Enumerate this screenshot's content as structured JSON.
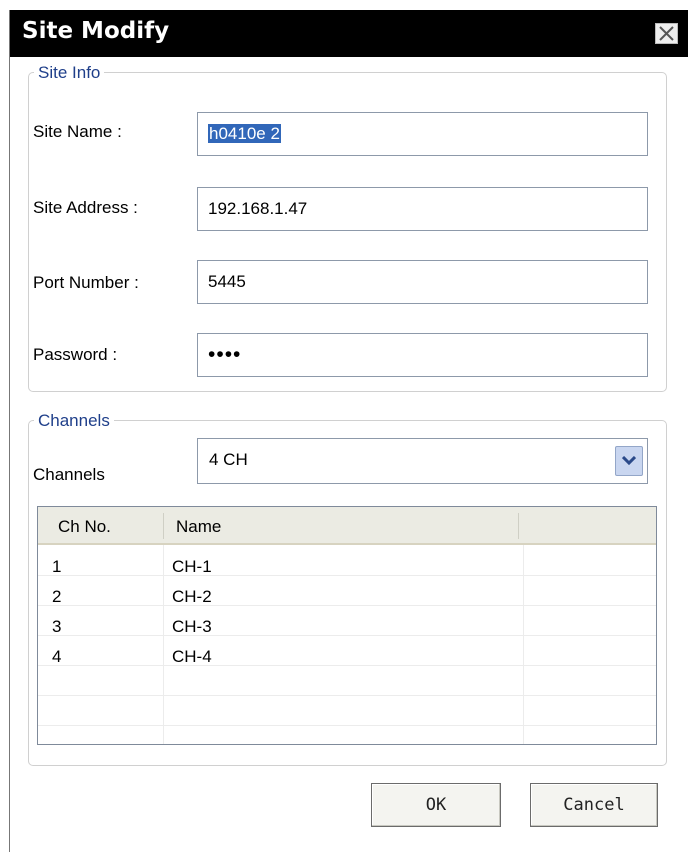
{
  "window": {
    "title": "Site Modify"
  },
  "site_info": {
    "legend": "Site Info",
    "fields": [
      {
        "label": "Site Name :",
        "value": "h0410e 2"
      },
      {
        "label": "Site Address :",
        "value": "192.168.1.47"
      },
      {
        "label": "Port Number :",
        "value": "5445"
      },
      {
        "label": "Password :",
        "value": "••••"
      }
    ]
  },
  "channels": {
    "legend": "Channels",
    "label": "Channels",
    "selected": "4 CH",
    "table": {
      "columns": [
        "Ch No.",
        "Name"
      ],
      "rows": [
        [
          "1",
          "CH-1"
        ],
        [
          "2",
          "CH-2"
        ],
        [
          "3",
          "CH-3"
        ],
        [
          "4",
          "CH-4"
        ]
      ]
    }
  },
  "buttons": {
    "ok": "OK",
    "cancel": "Cancel"
  },
  "colors": {
    "titlebar": "#000000",
    "legend_text": "#1f3f8a",
    "selection": "#3167b9"
  },
  "icons": {
    "close": "close-icon",
    "dropdown": "chevron-down-icon"
  }
}
